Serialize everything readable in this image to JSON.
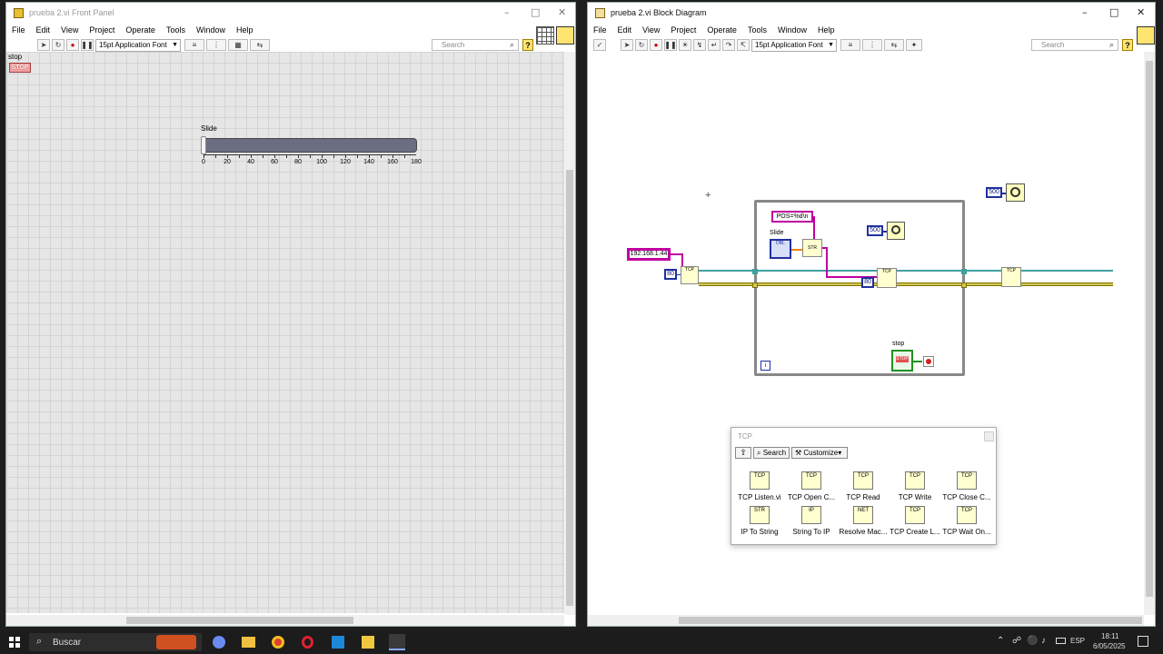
{
  "front_panel": {
    "title": "prueba 2.vi Front Panel",
    "menu": [
      "File",
      "Edit",
      "View",
      "Project",
      "Operate",
      "Tools",
      "Window",
      "Help"
    ],
    "font": "15pt Application Font",
    "search_placeholder": "Search",
    "stop_label": "stop",
    "stop_button": "STOP",
    "slide_label": "Slide",
    "slide_ticks": [
      "0",
      "20",
      "40",
      "60",
      "80",
      "100",
      "120",
      "140",
      "160",
      "180"
    ],
    "slide_value": 0
  },
  "block_diagram": {
    "title": "prueba 2.vi Block Diagram",
    "menu": [
      "File",
      "Edit",
      "View",
      "Project",
      "Operate",
      "Tools",
      "Window",
      "Help"
    ],
    "font": "15pt Application Font",
    "search_placeholder": "Search",
    "ip_const": "192.168.1.44",
    "port_const": "80",
    "format_const": "POS=%d\\n",
    "slide_label": "Slide",
    "wait_const_inner": "500",
    "wait_const_outer": "500",
    "write_timeout_const": "80",
    "stop_label": "stop",
    "stop_term": "STOP",
    "iteration": "i"
  },
  "palette": {
    "title": "TCP",
    "search": "Search",
    "customize": "Customize",
    "items": [
      {
        "label": "TCP Listen.vi",
        "icon": "TCP"
      },
      {
        "label": "TCP Open C...",
        "icon": "TCP"
      },
      {
        "label": "TCP Read",
        "icon": "TCP"
      },
      {
        "label": "TCP Write",
        "icon": "TCP"
      },
      {
        "label": "TCP Close C...",
        "icon": "TCP"
      },
      {
        "label": "IP To String",
        "icon": "STR"
      },
      {
        "label": "String To IP",
        "icon": "IP"
      },
      {
        "label": "Resolve Mac...",
        "icon": "NET"
      },
      {
        "label": "TCP Create L...",
        "icon": "TCP"
      },
      {
        "label": "TCP Wait On...",
        "icon": "TCP"
      }
    ]
  },
  "taskbar": {
    "search": "Buscar",
    "lang": "ESP",
    "time": "18:11",
    "date": "6/05/2025"
  },
  "colors": {
    "wire_string": "#c000a0",
    "wire_refnum": "#40a0a0",
    "wire_error": "#d0c850",
    "numeric_const": "#2030a0"
  }
}
